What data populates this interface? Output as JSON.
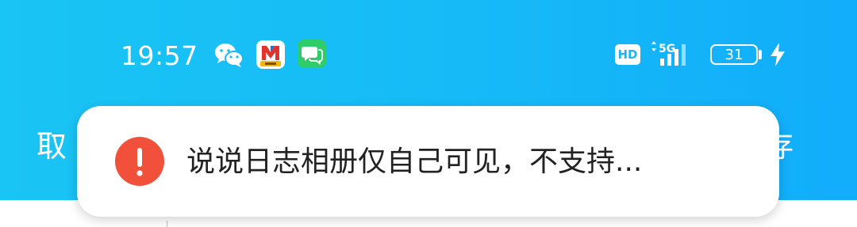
{
  "status_bar": {
    "time": "19:57",
    "network_badge": "HD",
    "network_type": "5G",
    "battery_level": "31",
    "notification_icons": [
      "wechat-icon",
      "app-icon",
      "message-icon"
    ]
  },
  "header": {
    "left_label": "取",
    "right_label": "存"
  },
  "toast": {
    "icon": "exclamation-icon",
    "message": "说说日志相册仅自己可见，不支持..."
  },
  "colors": {
    "header_gradient_start": "#19c5f4",
    "header_gradient_end": "#12adfb",
    "toast_icon": "#f1513a",
    "toast_bg": "#ffffff",
    "text": "#222222"
  }
}
